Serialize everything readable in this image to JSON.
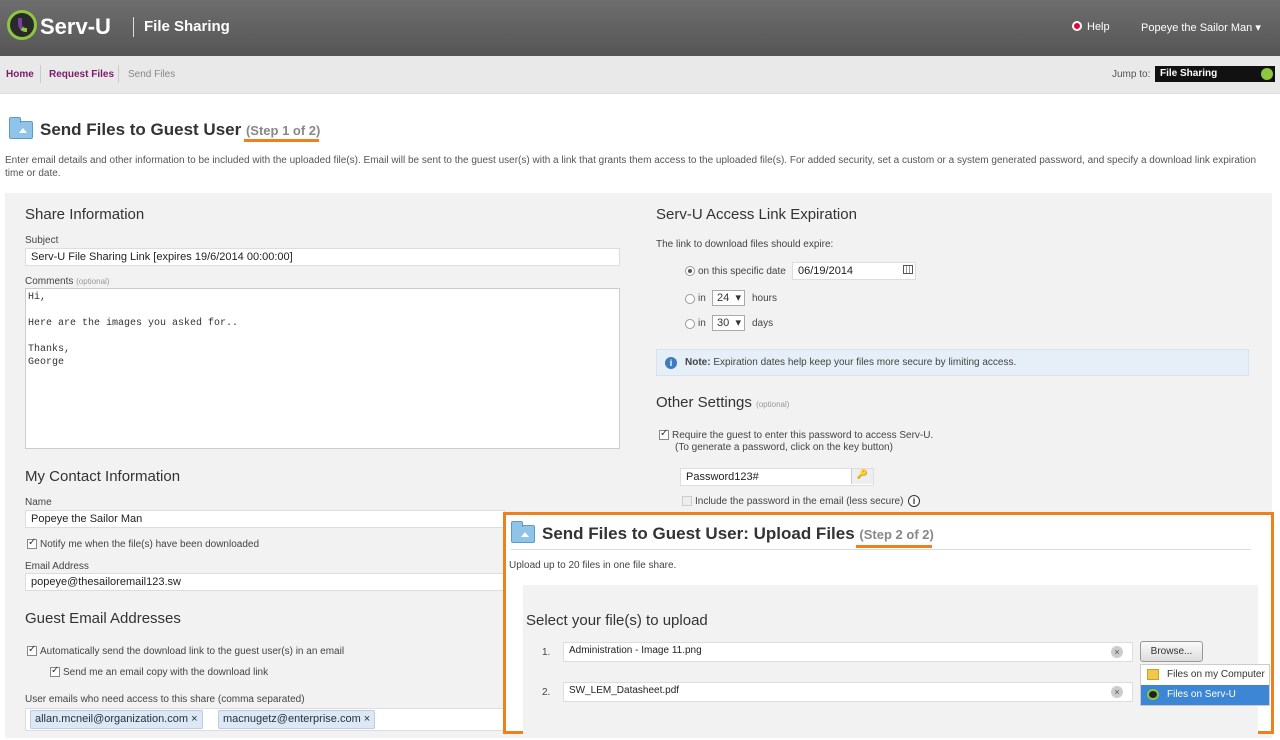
{
  "header": {
    "brand": "Serv-U",
    "app_title": "File Sharing",
    "help": "Help",
    "user": "Popeye the Sailor Man ▾"
  },
  "nav": {
    "home": "Home",
    "request_files": "Request Files",
    "send_files": "Send Files",
    "jump_label": "Jump to:",
    "jump_value": "File Sharing"
  },
  "page": {
    "title": "Send Files to Guest User",
    "step": "(Step 1 of 2)",
    "description": "Enter email details and other information to be included with the uploaded file(s). Email will be sent to the guest user(s) with a link that grants them access to the uploaded file(s). For added security, set a custom or a system generated password, and specify a download link expiration time or date."
  },
  "share": {
    "heading": "Share Information",
    "subject_label": "Subject",
    "subject": "Serv-U File Sharing Link [expires 19/6/2014 00:00:00]",
    "comments_label": "Comments",
    "optional": "(optional)",
    "comments": "Hi,\n\nHere are the images you asked for..\n\nThanks,\nGeorge"
  },
  "contact": {
    "heading": "My Contact Information",
    "name_label": "Name",
    "name": "Popeye the Sailor Man",
    "notify": "Notify me when the file(s) have been downloaded",
    "email_label": "Email Address",
    "email": "popeye@thesailoremail123.sw"
  },
  "guest": {
    "heading": "Guest Email Addresses",
    "auto_send": "Automatically send the download link to the guest user(s) in an email",
    "copy": "Send me an email copy with the download link",
    "emails_label": "User emails who need access to this share (comma separated)",
    "emails": [
      "allan.mcneil@organization.com",
      "macnugetz@enterprise.com"
    ],
    "remove_glyph": "×"
  },
  "expiration": {
    "heading": "Serv-U Access Link Expiration",
    "intro": "The link to download files should expire:",
    "opt_date": "on this specific date",
    "date": "06/19/2014",
    "opt_in": "in",
    "hours_value": "24",
    "hours": "hours",
    "days_value": "30",
    "days": "days",
    "note_bold": "Note:",
    "note_text": " Expiration dates help keep your files more secure by limiting access."
  },
  "other": {
    "heading": "Other Settings",
    "optional": "(optional)",
    "require_pw": "Require the guest to enter this password to access Serv-U.",
    "require_pw_hint": "(To generate a password, click on the key button)",
    "password": "Password123#",
    "include_pw": "Include the password in the email (less secure)"
  },
  "upload": {
    "title": "Send Files to Guest User: Upload Files",
    "step": "(Step 2 of 2)",
    "intro": "Upload up to 20 files in one file share.",
    "heading": "Select your file(s) to upload",
    "files": [
      {
        "num": "1.",
        "name": "Administration - Image 11.png"
      },
      {
        "num": "2.",
        "name": "SW_LEM_Datasheet.pdf"
      }
    ],
    "browse": "Browse...",
    "menu": [
      "Files on my Computer",
      "Files on Serv-U"
    ]
  },
  "colors": {
    "accent": "#f07f1e",
    "link": "#7a1c6a",
    "brand_green": "#8dc63f"
  }
}
